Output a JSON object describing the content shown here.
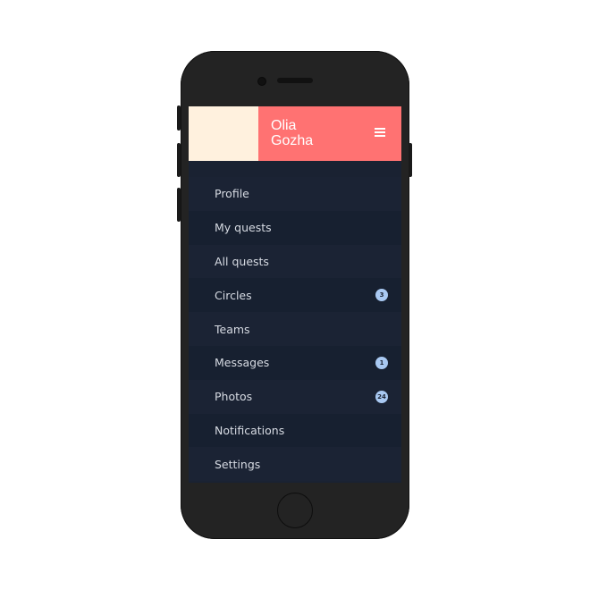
{
  "header": {
    "user_name_first": "Olia",
    "user_name_last": "Gozha",
    "menu_icon": "hamburger-icon"
  },
  "menu": {
    "items": [
      {
        "label": "Profile",
        "badge": null
      },
      {
        "label": "My quests",
        "badge": null
      },
      {
        "label": "All quests",
        "badge": null
      },
      {
        "label": "Circles",
        "badge": "3"
      },
      {
        "label": "Teams",
        "badge": null
      },
      {
        "label": "Messages",
        "badge": "1"
      },
      {
        "label": "Photos",
        "badge": "24"
      },
      {
        "label": "Notifications",
        "badge": null
      },
      {
        "label": "Settings",
        "badge": null
      }
    ]
  },
  "colors": {
    "header_accent": "#ff7272",
    "header_avatar_bg": "#fff1de",
    "menu_bg": "#1a2232",
    "badge_bg": "#a9c9f2",
    "phone_body": "#232323"
  }
}
